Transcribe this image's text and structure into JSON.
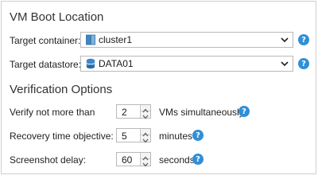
{
  "boot": {
    "title": "VM Boot Location",
    "container_label": "Target container:",
    "container_value": "cluster1",
    "datastore_label": "Target datastore:",
    "datastore_value": "DATA01"
  },
  "verification": {
    "title": "Verification Options",
    "vms_label": "Verify not more than",
    "vms_value": "2",
    "vms_unit": "VMs simultaneously",
    "rto_label": "Recovery time objective:",
    "rto_value": "5",
    "rto_unit": "minutes",
    "delay_label": "Screenshot delay:",
    "delay_value": "60",
    "delay_unit": "seconds"
  },
  "icons": {
    "help": "?",
    "container": "cluster-icon",
    "datastore": "database-icon"
  },
  "colors": {
    "help_blue": "#2f8fd8"
  }
}
